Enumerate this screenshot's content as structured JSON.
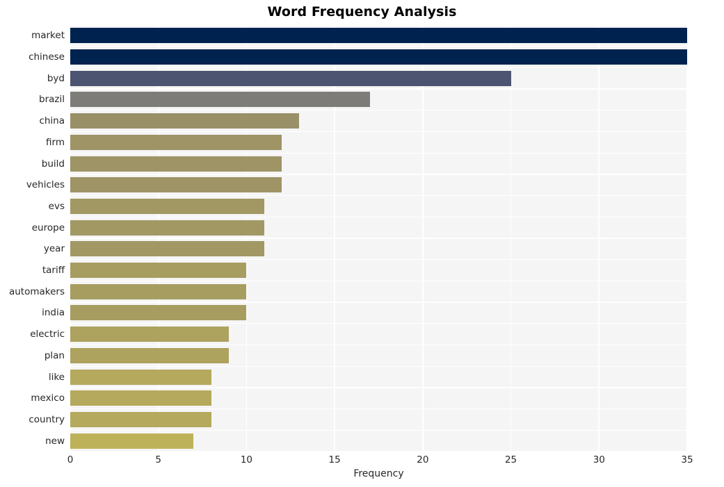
{
  "chart_data": {
    "type": "bar",
    "orientation": "horizontal",
    "title": "Word Frequency Analysis",
    "xlabel": "Frequency",
    "ylabel": "",
    "xlim": [
      0,
      35
    ],
    "ylim": [
      0,
      20
    ],
    "grid": true,
    "legend": null,
    "xticks": [
      "0",
      "5",
      "10",
      "15",
      "20",
      "25",
      "30",
      "35"
    ],
    "xtick_values": [
      0,
      5,
      10,
      15,
      20,
      25,
      30,
      35
    ],
    "categories": [
      "market",
      "chinese",
      "byd",
      "brazil",
      "china",
      "firm",
      "build",
      "vehicles",
      "evs",
      "europe",
      "year",
      "tariff",
      "automakers",
      "india",
      "electric",
      "plan",
      "like",
      "mexico",
      "country",
      "new"
    ],
    "values": [
      35,
      35,
      25,
      17,
      13,
      12,
      12,
      12,
      11,
      11,
      11,
      10,
      10,
      10,
      9,
      9,
      8,
      8,
      8,
      7
    ],
    "bar_colors": [
      "#00224e",
      "#00224e",
      "#4d5471",
      "#7d7c78",
      "#9a9068",
      "#9e9466",
      "#9e9466",
      "#9e9466",
      "#a29864",
      "#a29864",
      "#a29864",
      "#a79d61",
      "#a79d61",
      "#a79d61",
      "#ada25e",
      "#ada25e",
      "#b4a95c",
      "#b4a95c",
      "#b4a95c",
      "#bdb259"
    ],
    "plot_background": "#f5f5f5",
    "grid_color": "#ffffff",
    "figure_background": "#ffffff",
    "text_color": "#262626",
    "title_color": "#000000"
  }
}
